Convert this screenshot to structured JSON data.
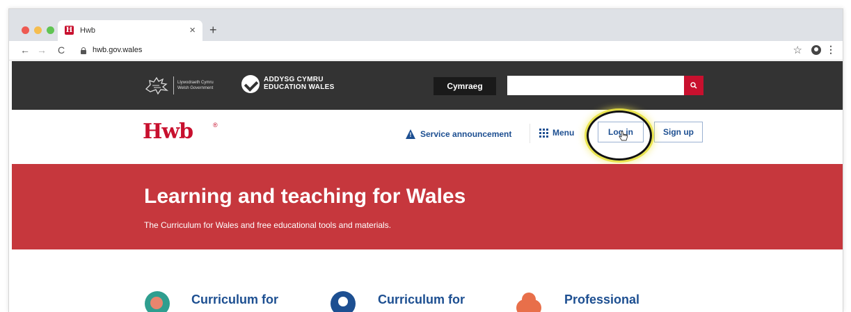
{
  "browser": {
    "tab_title": "Hwb",
    "tab_close": "×",
    "new_tab": "+",
    "url": "hwb.gov.wales",
    "favicon_letter": "H"
  },
  "header": {
    "gov_logo_line1": "Llywodraeth Cymru",
    "gov_logo_line2": "Welsh Government",
    "ew_logo_line1": "ADDYSG CYMRU",
    "ew_logo_line2": "EDUCATION WALES",
    "language_button": "Cymraeg",
    "search_placeholder": ""
  },
  "nav": {
    "logo": "Hwb",
    "logo_mark": "®",
    "service_announcement": "Service announcement",
    "menu": "Menu",
    "login": "Log in",
    "signup": "Sign up"
  },
  "hero": {
    "title": "Learning and teaching for Wales",
    "subtitle": "The Curriculum for Wales and free educational tools and materials."
  },
  "cards": [
    {
      "title": "Curriculum for"
    },
    {
      "title": "Curriculum for"
    },
    {
      "title": "Professional"
    }
  ],
  "colors": {
    "brand_red": "#c8102e",
    "hero_red": "#c6373d",
    "link_blue": "#1d4f91",
    "header_dark": "#333333"
  }
}
